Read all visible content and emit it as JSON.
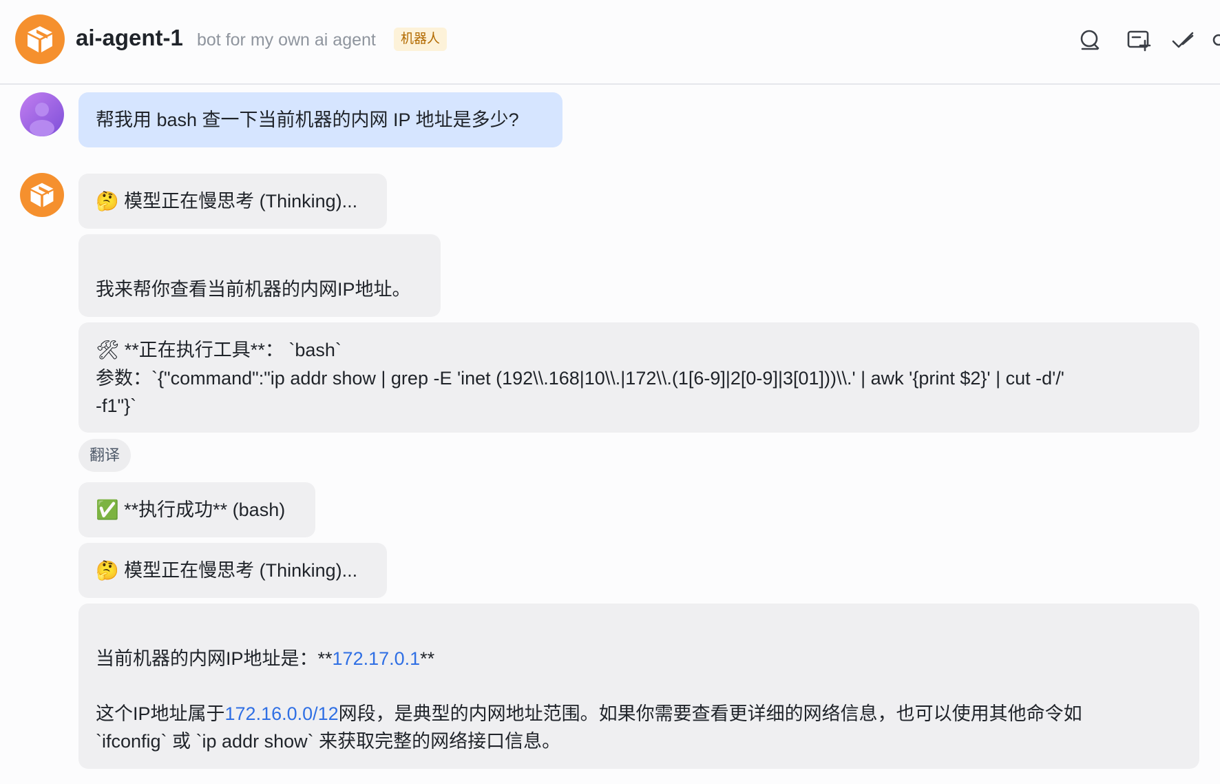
{
  "header": {
    "title": "ai-agent-1",
    "subtitle": "bot for my own ai agent",
    "badge": "机器人"
  },
  "messages": {
    "user_question": "帮我用 bash 查一下当前机器的内网 IP 地址是多少?",
    "thinking_1": "模型正在慢思考 (Thinking)...",
    "reply_1": "我来帮你查看当前机器的内网IP地址。",
    "tool_line_1": "**正在执行工具**： `bash`",
    "tool_line_2": "参数：`{\"command\":\"ip addr show | grep -E 'inet (192\\\\.168|10\\\\.|172\\\\.(1[6-9]|2[0-9]|3[01]))\\\\.' | awk '{print $2}' | cut -d'/'",
    "tool_line_3": "-f1\"}`",
    "translate_label": "翻译",
    "success": "**执行成功** (bash)",
    "thinking_2": "模型正在慢思考 (Thinking)...",
    "final_prefix": "当前机器的内网IP地址是：**",
    "final_ip": "172.17.0.1",
    "final_suffix": "**",
    "final_p2_prefix": "这个IP地址属于",
    "final_subnet": "172.16.0.0/12",
    "final_p2_rest": "网段，是典型的内网地址范围。如果你需要查看更详细的网络信息，也可以使用其他命令如",
    "final_p2_line2": "`ifconfig` 或 `ip addr show` 来获取完整的网络接口信息。"
  },
  "icons": {
    "tool": "hammer-wrench-icon",
    "check": "check-mark-button-icon",
    "thinking": "thinking-face-icon"
  },
  "colors": {
    "brand_orange": "#f5902e",
    "link_blue": "#2f6fe4",
    "user_bubble": "#d6e5ff",
    "bot_bubble": "#efeff1"
  }
}
